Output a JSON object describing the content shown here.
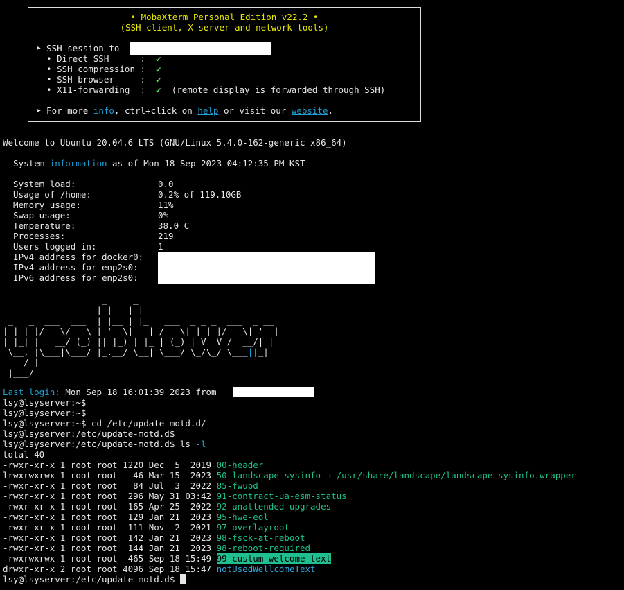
{
  "banner": {
    "title": "• MobaXterm Personal Edition v22.2 •",
    "subtitle": "(SSH client, X server and network tools)",
    "session_prefix": "➤ SSH session to",
    "rows": [
      {
        "label": "  • Direct SSH      :",
        "check": "✔",
        "note": ""
      },
      {
        "label": "  • SSH compression :",
        "check": "✔",
        "note": ""
      },
      {
        "label": "  • SSH-browser     :",
        "check": "✔",
        "note": ""
      },
      {
        "label": "  • X11-forwarding  :",
        "check": "✔",
        "note": "(remote display is forwarded through SSH)"
      }
    ],
    "more_prefix": "➤ For more ",
    "info_word": "info",
    "more_mid": ", ctrl+click on ",
    "help_link": "help",
    "more_mid2": " or visit our ",
    "website_link": "website",
    "more_end": "."
  },
  "welcome": "Welcome to Ubuntu 20.04.6 LTS (GNU/Linux 5.4.0-162-generic x86_64)",
  "sysinfo_prefix": "  System ",
  "sysinfo_word": "information",
  "sysinfo_suffix": " as of Mon 18 Sep 2023 04:12:35 PM KST",
  "stats": [
    {
      "label": "  System load:",
      "value": "0.0"
    },
    {
      "label": "  Usage of /home:",
      "value": "0.2% of 119.10GB"
    },
    {
      "label": "  Memory usage:",
      "value": "11%"
    },
    {
      "label": "  Swap usage:",
      "value": "0%"
    },
    {
      "label": "  Temperature:",
      "value": "38.0 C"
    },
    {
      "label": "  Processes:",
      "value": "219"
    },
    {
      "label": "  Users logged in:",
      "value": "1"
    },
    {
      "label": "  IPv4 address for docker0:",
      "value": ""
    },
    {
      "label": "  IPv4 address for enp2s0:",
      "value": ""
    },
    {
      "label": "  IPv6 address for enp2s0:",
      "value": ""
    }
  ],
  "last_login_label": "Last login:",
  "last_login_text": " Mon Sep 18 16:01:39 2023 from",
  "prompts": [
    "lsy@lsyserver:~$",
    "lsy@lsyserver:~$",
    "lsy@lsyserver:~$ cd /etc/update-motd.d/",
    "lsy@lsyserver:/etc/update-motd.d$"
  ],
  "ls_prompt": "lsy@lsyserver:/etc/update-motd.d$ ls ",
  "ls_flag": "-l",
  "total": "total 40",
  "files": [
    {
      "meta": "-rwxr-xr-x 1 root root 1220 Dec  5  2019 ",
      "name": "00-header",
      "style": "teal",
      "target": ""
    },
    {
      "meta": "lrwxrwxrwx 1 root root   46 Mar 15  2023 ",
      "name": "50-landscape-sysinfo",
      "style": "teal",
      "target": " → /usr/share/landscape/landscape-sysinfo.wrapper"
    },
    {
      "meta": "-rwxr-xr-x 1 root root   84 Jul  3  2022 ",
      "name": "85-fwupd",
      "style": "teal",
      "target": ""
    },
    {
      "meta": "-rwxr-xr-x 1 root root  296 May 31 03:42 ",
      "name": "91-contract-ua-esm-status",
      "style": "teal",
      "target": ""
    },
    {
      "meta": "-rwxr-xr-x 1 root root  165 Apr 25  2022 ",
      "name": "92-unattended-upgrades",
      "style": "teal",
      "target": ""
    },
    {
      "meta": "-rwxr-xr-x 1 root root  129 Jan 21  2023 ",
      "name": "95-hwe-eol",
      "style": "teal",
      "target": ""
    },
    {
      "meta": "-rwxr-xr-x 1 root root  111 Nov  2  2021 ",
      "name": "97-overlayroot",
      "style": "teal",
      "target": ""
    },
    {
      "meta": "-rwxr-xr-x 1 root root  142 Jan 21  2023 ",
      "name": "98-fsck-at-reboot",
      "style": "teal",
      "target": ""
    },
    {
      "meta": "-rwxr-xr-x 1 root root  144 Jan 21  2023 ",
      "name": "98-reboot-required",
      "style": "teal",
      "target": ""
    },
    {
      "meta": "-rwxrwxrwx 1 root root  465 Sep 18 15:49 ",
      "name": "99-custum-welcome-text",
      "style": "hl",
      "target": ""
    },
    {
      "meta": "drwxr-xr-x 2 root root 4096 Sep 18 15:47 ",
      "name": "notUsedWellcomeText",
      "style": "blue",
      "target": ""
    }
  ],
  "final_prompt": "lsy@lsyserver:/etc/update-motd.d$ ",
  "colors": {
    "accent_green": "#1fbf8f",
    "link_blue": "#1f9fd6",
    "banner_yellow": "#e6e600",
    "check_green": "#5fd75f"
  }
}
